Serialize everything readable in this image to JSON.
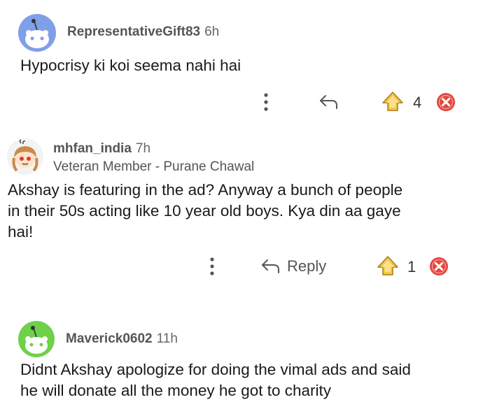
{
  "comments": [
    {
      "username": "RepresentativeGift83",
      "age": "6h",
      "body": "Hypocrisy ki koi seema nahi hai",
      "upvote_count": "4",
      "avatar_color": "#7f9fe9"
    },
    {
      "username": "mhfan_india",
      "age": "7h",
      "flair": "Veteran Member - Purane Chawal",
      "body_lines": [
        "Akshay is featuring in the ad? Anyway a bunch of people",
        "in their 50s acting like 10 year old boys. Kya din aa gaye",
        "hai!"
      ],
      "reply_label": "Reply",
      "upvote_count": "1"
    },
    {
      "username": "Maverick0602",
      "age": "11h",
      "body_lines": [
        "Didnt Akshay apologize for doing the vimal ads and said",
        "he will donate all the money he got to charity"
      ],
      "avatar_color": "#6fd14a"
    }
  ],
  "icons": {
    "more": "more-vertical-icon",
    "reply": "reply-arrow-icon",
    "upvote": "upvote-award-icon",
    "downvote": "downvote-close-icon"
  },
  "colors": {
    "downvote_red": "#e4463d",
    "upvote_gold": "#f2c84b"
  }
}
